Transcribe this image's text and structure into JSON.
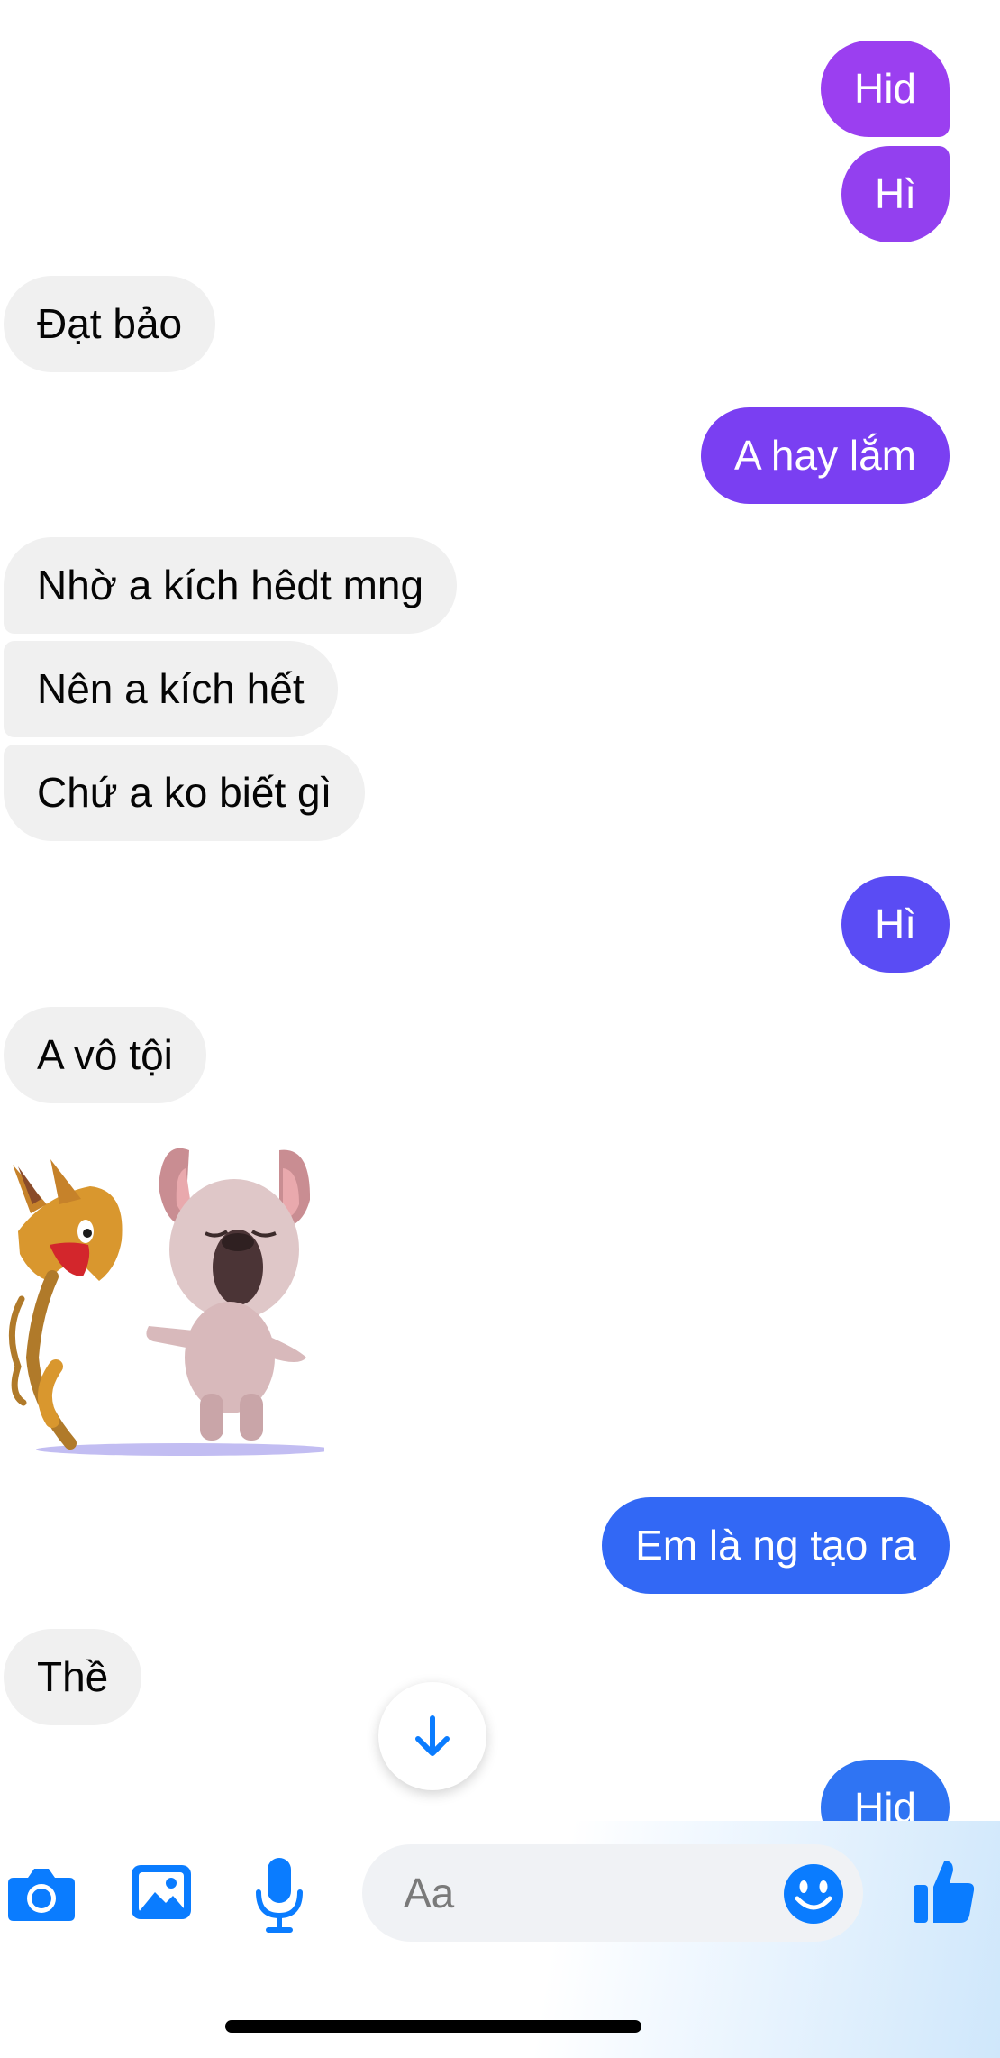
{
  "messages": [
    {
      "dir": "out",
      "text": "Hid",
      "color": "#9b3ff0"
    },
    {
      "dir": "out",
      "text": "Hì",
      "color": "#9340ef"
    },
    {
      "dir": "in",
      "text": "Đạt bảo"
    },
    {
      "dir": "out",
      "text": "A hay lắm",
      "color": "#7a3ff2"
    },
    {
      "dir": "in",
      "text": "Nhờ a kích hêdt mng"
    },
    {
      "dir": "in",
      "text": "Nên a kích hết"
    },
    {
      "dir": "in",
      "text": "Chứ a ko biết gì"
    },
    {
      "dir": "out",
      "text": "Hì",
      "color": "#5a4cf4"
    },
    {
      "dir": "in",
      "text": "A vô tội"
    },
    {
      "dir": "in",
      "type": "sticker",
      "icon": "cat-and-dog-sticker"
    },
    {
      "dir": "out",
      "text": "Em là ng tạo ra",
      "color": "#3268f5"
    },
    {
      "dir": "in",
      "text": "Thề"
    },
    {
      "dir": "out",
      "text": "Hid",
      "color": "#2f74f3"
    }
  ],
  "scroll_button": {
    "icon": "arrow-down-icon"
  },
  "composer": {
    "placeholder": "Aa",
    "accent": "#0a7cff",
    "icons": [
      "camera-icon",
      "image-icon",
      "microphone-icon",
      "emoji-icon",
      "thumbs-up-icon"
    ]
  }
}
